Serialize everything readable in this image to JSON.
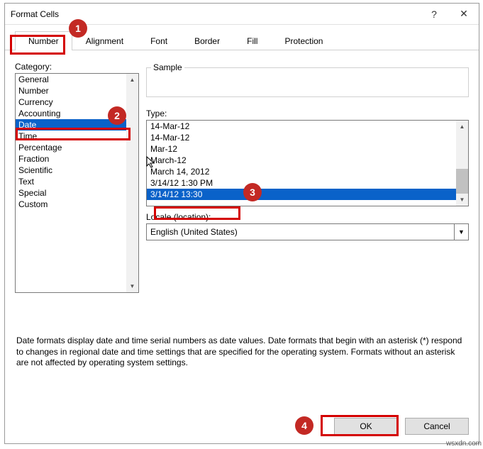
{
  "title": "Format Cells",
  "titlebar": {
    "help": "?",
    "close": "✕"
  },
  "tabs": [
    "Number",
    "Alignment",
    "Font",
    "Border",
    "Fill",
    "Protection"
  ],
  "activeTab": 0,
  "category": {
    "label": "Category:",
    "items": [
      "General",
      "Number",
      "Currency",
      "Accounting",
      "Date",
      "Time",
      "Percentage",
      "Fraction",
      "Scientific",
      "Text",
      "Special",
      "Custom"
    ],
    "selectedIndex": 4
  },
  "sample": {
    "label": "Sample"
  },
  "type": {
    "label": "Type:",
    "items": [
      "14-Mar-12",
      "14-Mar-12",
      "Mar-12",
      "March-12",
      "March 14, 2012",
      "3/14/12 1:30 PM",
      "3/14/12 13:30"
    ],
    "selectedIndex": 6
  },
  "locale": {
    "label": "Locale (location):",
    "value": "English (United States)"
  },
  "hint": "Date formats display date and time serial numbers as date values.  Date formats that begin with an asterisk (*) respond to changes in regional date and time settings that are specified for the operating system. Formats without an asterisk are not affected by operating system settings.",
  "buttons": {
    "ok": "OK",
    "cancel": "Cancel"
  },
  "badges": {
    "b1": "1",
    "b2": "2",
    "b3": "3",
    "b4": "4"
  },
  "watermark": "wsxdn.com"
}
